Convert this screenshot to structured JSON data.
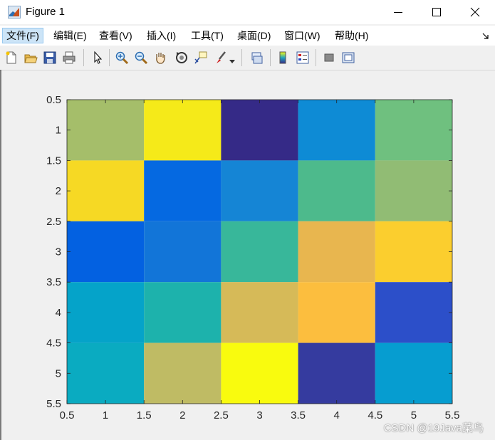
{
  "window": {
    "title": "Figure 1",
    "controls": [
      "minimize",
      "maximize",
      "close"
    ]
  },
  "menubar": {
    "items": [
      {
        "label": "文件(F)",
        "active": true
      },
      {
        "label": "编辑(E)"
      },
      {
        "label": "查看(V)"
      },
      {
        "label": "插入(I)"
      },
      {
        "label": "工具(T)"
      },
      {
        "label": "桌面(D)"
      },
      {
        "label": "窗口(W)"
      },
      {
        "label": "帮助(H)"
      }
    ],
    "dock_icon": "dock-arrow-icon"
  },
  "toolbar": {
    "icons": [
      "new-figure-icon",
      "open-file-icon",
      "save-icon",
      "print-icon",
      "edit-plot-icon",
      "zoom-in-icon",
      "zoom-out-icon",
      "pan-icon",
      "rotate-3d-icon",
      "data-cursor-icon",
      "brush-icon",
      "link-plot-icon",
      "insert-colorbar-icon",
      "insert-legend-icon",
      "hide-plot-tools-icon",
      "show-plot-tools-icon"
    ]
  },
  "chart_data": {
    "type": "heatmap",
    "colormap": "parula",
    "rows": 5,
    "cols": 5,
    "values": [
      [
        17,
        24,
        1,
        8,
        15
      ],
      [
        23,
        5,
        7,
        14,
        16
      ],
      [
        4,
        6,
        13,
        20,
        22
      ],
      [
        10,
        12,
        19,
        21,
        3
      ],
      [
        11,
        18,
        25,
        2,
        9
      ]
    ],
    "xlim": [
      0.5,
      5.5
    ],
    "ylim": [
      0.5,
      5.5
    ],
    "y_direction": "reverse",
    "xticks": [
      "0.5",
      "1",
      "1.5",
      "2",
      "2.5",
      "3",
      "3.5",
      "4",
      "4.5",
      "5",
      "5.5"
    ],
    "yticks": [
      "0.5",
      "1",
      "1.5",
      "2",
      "2.5",
      "3",
      "3.5",
      "4",
      "4.5",
      "5",
      "5.5"
    ],
    "cell_colors": [
      [
        "#a5be6a",
        "#f5ea19",
        "#352a87",
        "#0e8bd5",
        "#6fc07f"
      ],
      [
        "#f6d924",
        "#0569e1",
        "#1585d5",
        "#4dba8c",
        "#91bc74"
      ],
      [
        "#0361e1",
        "#1275d8",
        "#38b79a",
        "#e8b64f",
        "#fbce2e"
      ],
      [
        "#05a3c9",
        "#1db2ac",
        "#d6ba58",
        "#fcbe3e",
        "#2c4fc9"
      ],
      [
        "#0aabc1",
        "#bfbb64",
        "#f9fb0e",
        "#353b9f",
        "#069dd0"
      ]
    ]
  },
  "watermark": "CSDN @19Java菜鸟"
}
